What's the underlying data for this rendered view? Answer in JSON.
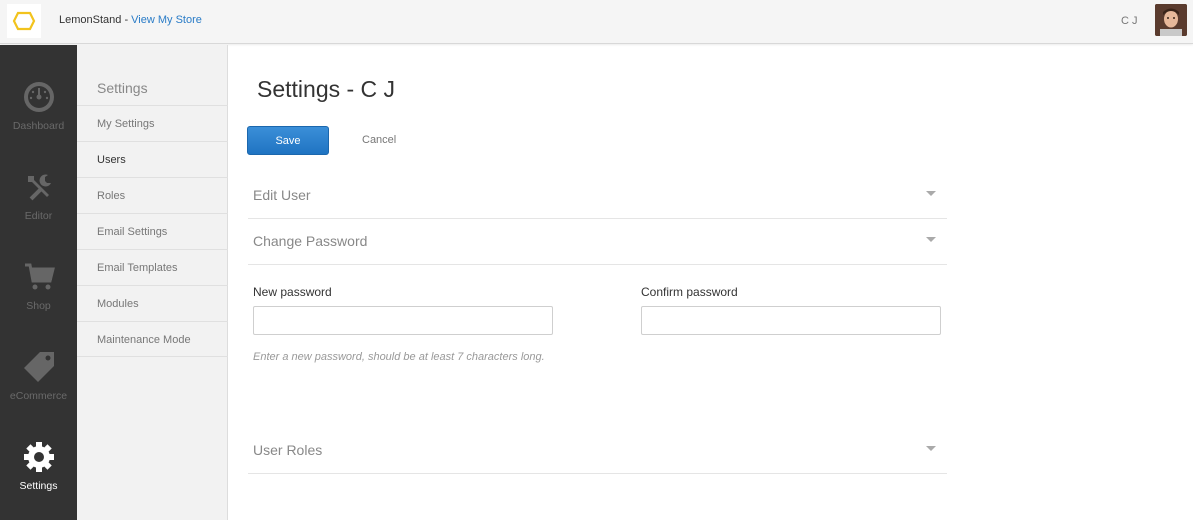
{
  "header": {
    "brand": "LemonStand",
    "separator": " - ",
    "store_link": "View My Store",
    "user_initials": "C J"
  },
  "icon_names": {
    "logo": "lemonstand-logo-icon",
    "dashboard": "gauge-icon",
    "editor": "tools-icon",
    "shop": "cart-icon",
    "ecommerce": "tag-icon",
    "settings": "gear-icon"
  },
  "leftnav": {
    "dashboard": "Dashboard",
    "editor": "Editor",
    "shop": "Shop",
    "ecommerce": "eCommerce",
    "settings": "Settings"
  },
  "submenu": {
    "title": "Settings",
    "items": [
      {
        "label": "My Settings"
      },
      {
        "label": "Users"
      },
      {
        "label": "Roles"
      },
      {
        "label": "Email Settings"
      },
      {
        "label": "Email Templates"
      },
      {
        "label": "Modules"
      },
      {
        "label": "Maintenance Mode"
      }
    ],
    "active": "Users"
  },
  "main": {
    "title": "Settings - C J",
    "save_label": "Save",
    "cancel_label": "Cancel",
    "sections": {
      "edit_user": "Edit User",
      "change_password": "Change Password",
      "user_roles": "User Roles"
    },
    "new_password_label": "New password",
    "new_password_value": "",
    "confirm_password_label": "Confirm password",
    "confirm_password_value": "",
    "password_hint": "Enter a new password, should be at least 7 characters long."
  },
  "colors": {
    "accent": "#2a7cc7",
    "save_button": "#2a80cf",
    "nav_bg": "#333333",
    "logo_yellow": "#f2c31d"
  }
}
